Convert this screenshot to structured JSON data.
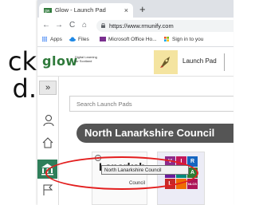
{
  "slide": {
    "line1": "ck",
    "line2": "d."
  },
  "browser": {
    "tab_title": "Glow - Launch Pad",
    "tab_close": "×",
    "new_tab": "+",
    "url": "https://www.rmunify.com",
    "nav": {
      "back": "←",
      "forward": "→",
      "reload": "C",
      "home": "⌂"
    },
    "bookmarks": [
      "Apps",
      "Files",
      "Microsoft Office Ho...",
      "Sign in to you"
    ]
  },
  "glow": {
    "logo": "glow",
    "tagline": "Digital Learning for Scotland",
    "launch_pad_label": "Launch Pad"
  },
  "rail": {
    "expand": "»"
  },
  "main": {
    "search_placeholder": "Search Launch Pads",
    "council_title": "North Lanarkshire Council",
    "tile_info": "i",
    "tile_name": "Lanarksh",
    "tile_council_word": "Council",
    "grid_letters": [
      "V",
      "I",
      "R",
      "T",
      "U",
      "A",
      "L",
      "",
      "NLCS"
    ]
  },
  "tooltip": {
    "text": "North Lanarkshire Council"
  },
  "colors": {
    "glow_green": "#2f7a3b",
    "council_banner": "#555555",
    "annotation_red": "#e31e1e",
    "rail_active": "#2f7f5a"
  }
}
